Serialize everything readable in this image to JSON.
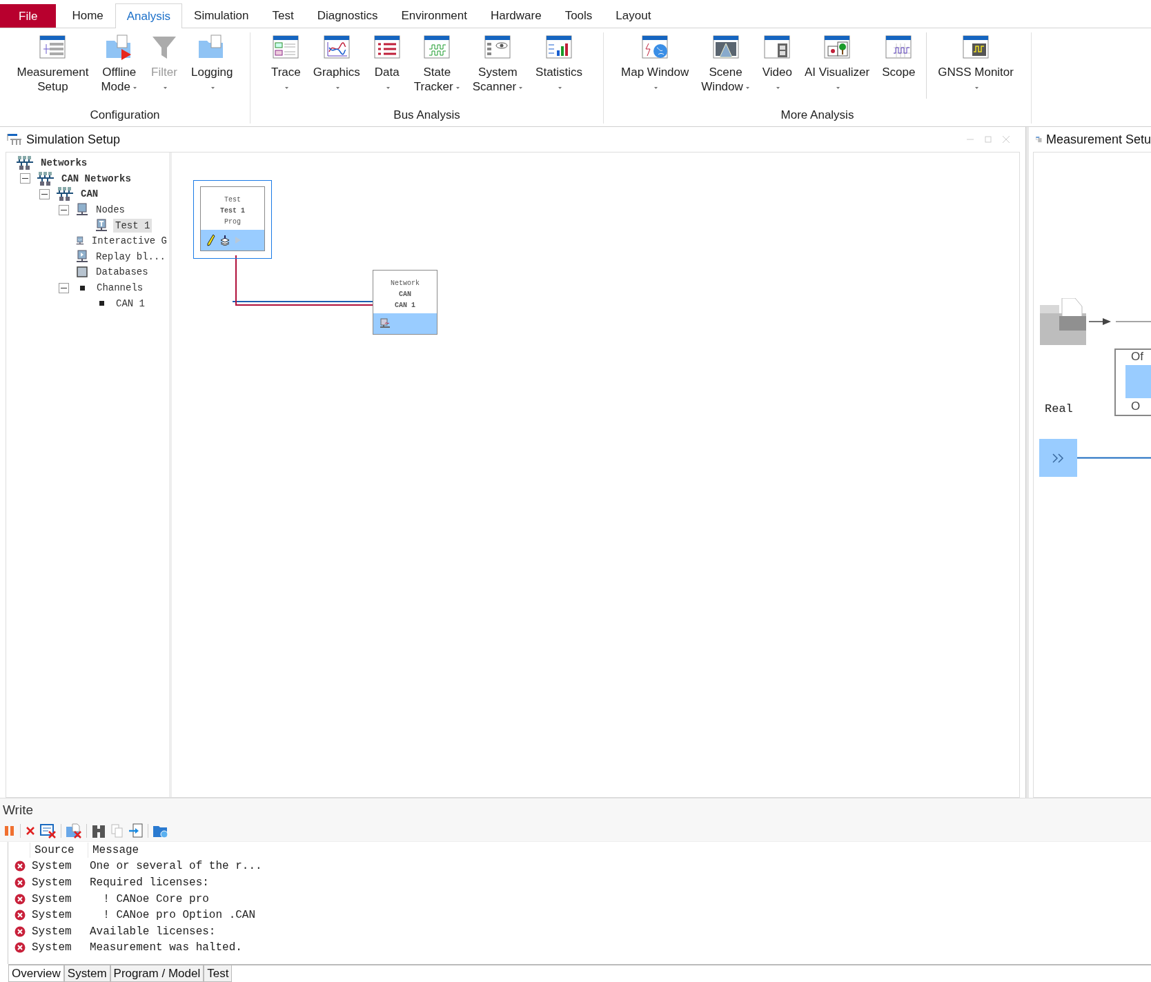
{
  "menu_tabs": [
    {
      "label": "File",
      "kind": "file",
      "selected": false
    },
    {
      "label": "Home",
      "kind": "tab",
      "selected": false
    },
    {
      "label": "Analysis",
      "kind": "tab",
      "selected": true
    },
    {
      "label": "Simulation",
      "kind": "tab",
      "selected": false
    },
    {
      "label": "Test",
      "kind": "tab",
      "selected": false
    },
    {
      "label": "Diagnostics",
      "kind": "tab",
      "selected": false
    },
    {
      "label": "Environment",
      "kind": "tab",
      "selected": false
    },
    {
      "label": "Hardware",
      "kind": "tab",
      "selected": false
    },
    {
      "label": "Tools",
      "kind": "tab",
      "selected": false
    },
    {
      "label": "Layout",
      "kind": "tab",
      "selected": false
    }
  ],
  "ribbon_groups": [
    {
      "label": "Configuration",
      "buttons": [
        {
          "label": "Measurement\nSetup",
          "dropdown": false,
          "disabled": false,
          "separator_before": false
        },
        {
          "label": "Offline\nMode",
          "dropdown": true,
          "disabled": false,
          "separator_before": false
        },
        {
          "label": "Filter",
          "dropdown": true,
          "disabled": true,
          "separator_before": false
        },
        {
          "label": "Logging",
          "dropdown": true,
          "disabled": false,
          "separator_before": false
        }
      ]
    },
    {
      "label": "Bus Analysis",
      "buttons": [
        {
          "label": "Trace",
          "dropdown": true,
          "disabled": false,
          "separator_before": false
        },
        {
          "label": "Graphics",
          "dropdown": true,
          "disabled": false,
          "separator_before": false
        },
        {
          "label": "Data",
          "dropdown": true,
          "disabled": false,
          "separator_before": false
        },
        {
          "label": "State\nTracker",
          "dropdown": true,
          "disabled": false,
          "separator_before": false
        },
        {
          "label": "System\nScanner",
          "dropdown": true,
          "disabled": false,
          "separator_before": false
        },
        {
          "label": "Statistics",
          "dropdown": true,
          "disabled": false,
          "separator_before": false
        }
      ]
    },
    {
      "label": "More Analysis",
      "buttons": [
        {
          "label": "Map Window",
          "dropdown": true,
          "disabled": false,
          "separator_before": false
        },
        {
          "label": "Scene\nWindow",
          "dropdown": true,
          "disabled": false,
          "separator_before": false
        },
        {
          "label": "Video",
          "dropdown": true,
          "disabled": false,
          "separator_before": false
        },
        {
          "label": "AI Visualizer",
          "dropdown": true,
          "disabled": false,
          "separator_before": false
        },
        {
          "label": "Scope",
          "dropdown": false,
          "disabled": false,
          "separator_before": false
        },
        {
          "label": "GNSS Monitor",
          "dropdown": true,
          "disabled": false,
          "separator_before": true
        }
      ]
    }
  ],
  "simulation_setup": {
    "title": "Simulation Setup",
    "tree": [
      {
        "label": "Networks",
        "kind": "network",
        "bold": true,
        "selected": false,
        "children": [
          {
            "label": "CAN Networks",
            "kind": "network",
            "bold": true,
            "selected": false,
            "expanded": true,
            "children": [
              {
                "label": "CAN",
                "kind": "network",
                "bold": true,
                "selected": false,
                "expanded": true,
                "children": [
                  {
                    "label": "Nodes",
                    "kind": "node",
                    "bold": false,
                    "selected": false,
                    "expanded": true,
                    "children": [
                      {
                        "label": "Test 1",
                        "kind": "test",
                        "bold": false,
                        "selected": true
                      }
                    ]
                  },
                  {
                    "label": "Interactive G",
                    "kind": "interactive",
                    "bold": false,
                    "selected": false
                  },
                  {
                    "label": "Replay bl...",
                    "kind": "replay",
                    "bold": false,
                    "selected": false
                  },
                  {
                    "label": "Databases",
                    "kind": "database",
                    "bold": false,
                    "selected": false
                  },
                  {
                    "label": "Channels",
                    "kind": "channel",
                    "bold": false,
                    "selected": false,
                    "expanded": true,
                    "children": [
                      {
                        "label": "CAN 1",
                        "kind": "channel",
                        "bold": false,
                        "selected": false
                      }
                    ]
                  }
                ]
              }
            ]
          }
        ]
      }
    ],
    "nodes": [
      {
        "kind": "test",
        "selected": true,
        "lines": [
          {
            "text": "Test",
            "bold": false
          },
          {
            "text": "Test 1",
            "bold": true
          },
          {
            "text": "Prog",
            "bold": false
          }
        ]
      },
      {
        "kind": "network",
        "selected": false,
        "lines": [
          {
            "text": "Network",
            "bold": false
          },
          {
            "text": "CAN",
            "bold": true
          },
          {
            "text": "CAN 1",
            "bold": true
          }
        ]
      }
    ]
  },
  "measurement_setup": {
    "title": "Measurement Setu",
    "offline_box": [
      "Of",
      "O"
    ],
    "real_label": "Real"
  },
  "write": {
    "title": "Write",
    "columns": [
      "Source",
      "Message"
    ],
    "rows": [
      {
        "source": "System",
        "message": "One or several of the r..."
      },
      {
        "source": "System",
        "message": "Required licenses:"
      },
      {
        "source": "System",
        "message": "  ! CANoe Core pro"
      },
      {
        "source": "System",
        "message": "  ! CANoe pro Option .CAN"
      },
      {
        "source": "System",
        "message": "Available licenses:"
      },
      {
        "source": "System",
        "message": "Measurement was halted."
      }
    ]
  },
  "bottom_tabs": [
    {
      "label": "Overview",
      "selected": true
    },
    {
      "label": "System",
      "selected": false
    },
    {
      "label": "Program / Model",
      "selected": false
    },
    {
      "label": "Test",
      "selected": false
    }
  ]
}
